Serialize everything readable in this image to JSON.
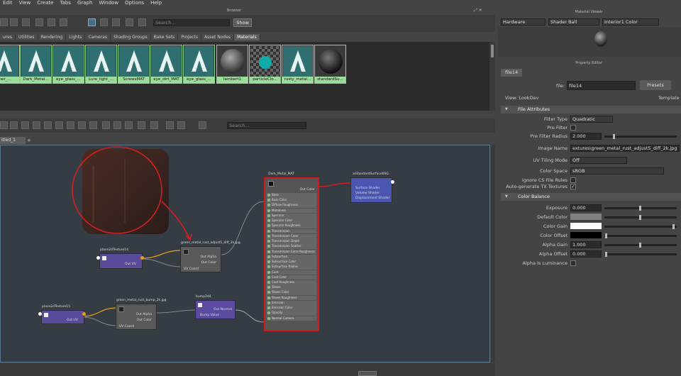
{
  "menu": [
    "Edit",
    "View",
    "Create",
    "Tabs",
    "Graph",
    "Window",
    "Options",
    "Help"
  ],
  "browser": {
    "title": "Browser",
    "search_placeholder": "Search...",
    "show_label": "Show",
    "tabs": [
      "ures",
      "Utilities",
      "Rendering",
      "Lights",
      "Cameras",
      "Shading Groups",
      "Bake Sets",
      "Projects",
      "Asset Nodes",
      "Materials"
    ],
    "active_tab": "Materials",
    "swatches": [
      "aner_...",
      "Dark_Metal...",
      "eye_glass_...",
      "Lure_light_...",
      "ScrewsMAT",
      "eye_dirt_MAT",
      "eye_glass_...",
      "lambert1",
      "particleClo...",
      "rusty_metal...",
      "standardSu..."
    ]
  },
  "graph": {
    "search_placeholder": "Search...",
    "tab_label": "itled_1",
    "add_tab": "+"
  },
  "nodes": {
    "place2d_14": {
      "title": "place2dTexture14",
      "out": "Out UV"
    },
    "place2d_15": {
      "title": "place2dTexture15",
      "out": "Out UV"
    },
    "file_diff": {
      "title": "green_metal_rust_adjust5_diff_2k.jpg",
      "alpha": "Out Alpha",
      "color": "Out Color",
      "uv": "UV Coord"
    },
    "file_bump": {
      "title": "green_metal_rust_bump_2k.jpg",
      "alpha": "Out Alpha",
      "color": "Out Color",
      "uv": "UV Coord"
    },
    "bump": {
      "title": "bump2d4",
      "out": "Out Normal",
      "in": "Bump Value"
    },
    "material": {
      "title": "Dark_Metal_MAT",
      "out": "Out Color",
      "attrs": [
        "Base",
        "Base Color",
        "Diffuse Roughness",
        "Metalness",
        "Specular",
        "Specular Color",
        "Specular Roughness",
        "Transmission",
        "Transmission Color",
        "Transmission Depth",
        "Transmission Scatter",
        "Transmission Extra Roughness",
        "Subsurface",
        "Subsurface Color",
        "Subsurface Radius",
        "Coat",
        "Coat Color",
        "Coat Roughness",
        "Sheen",
        "Sheen Color",
        "Sheen Roughness",
        "Emission",
        "Emission Color",
        "Opacity",
        "Normal Camera"
      ]
    },
    "sg": {
      "title": "aiStandardSurface6SG",
      "attrs": [
        "Surface Shader",
        "Volume Shader",
        "Displacement Shader"
      ]
    }
  },
  "viewer": {
    "title": "Material Viewer",
    "renderer": "Hardware",
    "shape": "Shader Ball",
    "env": "Interior1 Color"
  },
  "props": {
    "title": "Property Editor",
    "node_tab": "file14",
    "file_label": "file:",
    "file_value": "file14",
    "presets": "Presets",
    "view_label": "View: LookDev",
    "template": "Template",
    "section_file": "File Attributes",
    "filter_type_label": "Filter Type",
    "filter_type": "Quadratic",
    "pre_filter_label": "Pre Filter",
    "pre_filter_radius_label": "Pre Filter Radius",
    "pre_filter_radius": "2.000",
    "image_name_label": "Image Name",
    "image_name": "extures\\green_metal_rust_adjust5_diff_2k.jpg",
    "uv_tiling_label": "UV Tiling Mode",
    "uv_tiling": "Off",
    "color_space_label": "Color Space",
    "color_space": "sRGB",
    "ignore_cs_label": "Ignore CS File Rules",
    "auto_tx_label": "Auto-generate TX Textures",
    "section_balance": "Color Balance",
    "exposure_label": "Exposure",
    "exposure": "0.000",
    "default_color_label": "Default Color",
    "color_gain_label": "Color Gain",
    "color_offset_label": "Color Offset",
    "alpha_gain_label": "Alpha Gain",
    "alpha_gain": "1.000",
    "alpha_offset_label": "Alpha Offset",
    "alpha_offset": "0.000",
    "alpha_lum_label": "Alpha Is Luminance"
  },
  "colors": {
    "material_border": "#d11a1a",
    "selection_green": "#9bdb9b",
    "bump_node": "#5b4aa0",
    "annotation_red": "#d02020"
  }
}
